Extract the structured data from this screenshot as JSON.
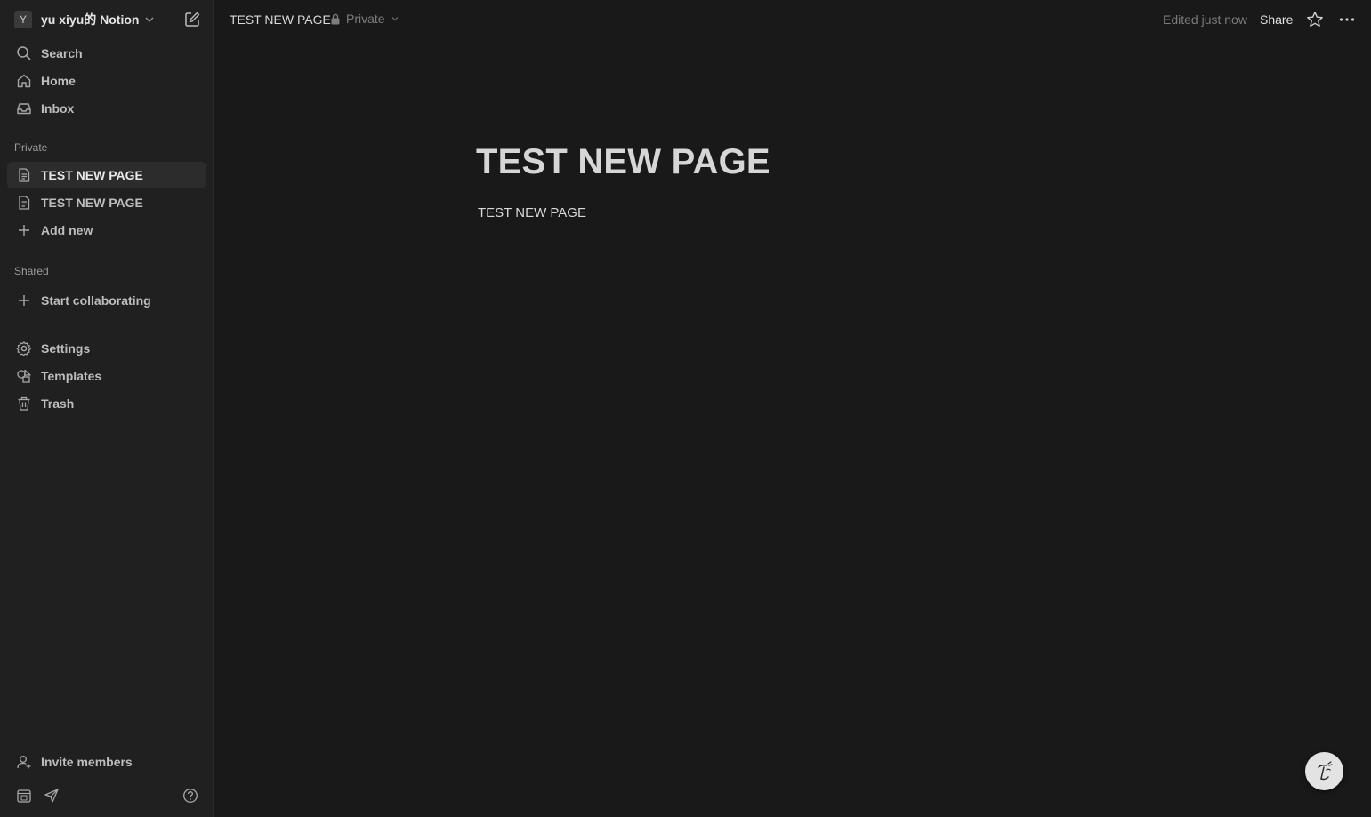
{
  "workspace": {
    "avatar_letter": "Y",
    "name": "yu xiyu的 Notion"
  },
  "nav": {
    "search": "Search",
    "home": "Home",
    "inbox": "Inbox"
  },
  "sections": {
    "private": "Private",
    "shared": "Shared"
  },
  "private_pages": [
    {
      "label": "TEST NEW PAGE",
      "active": true
    },
    {
      "label": "TEST NEW PAGE",
      "active": false
    }
  ],
  "add_new": "Add new",
  "start_collaborating": "Start collaborating",
  "utility": {
    "settings": "Settings",
    "templates": "Templates",
    "trash": "Trash"
  },
  "invite": "Invite members",
  "topbar": {
    "breadcrumb": "TEST NEW PAGE",
    "privacy": "Private",
    "edited": "Edited just now",
    "share": "Share"
  },
  "page": {
    "title": "TEST NEW PAGE",
    "body": "TEST NEW PAGE"
  },
  "colors": {
    "background": "#191919",
    "sidebar": "#202020",
    "active_item": "#2c2c2c"
  }
}
